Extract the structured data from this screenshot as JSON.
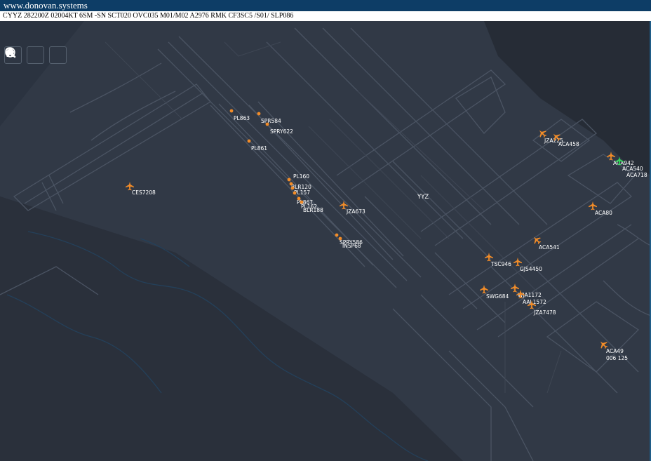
{
  "site": {
    "title": "www.donovan.systems"
  },
  "metar": "CYYZ 282200Z 02004KT 6SM -SN SCT020 OVC035 M01/M02 A2976 RMK CF3SC5 /S01/ SLP086",
  "toolbar": [
    {
      "name": "home-button",
      "icon": "home-icon"
    },
    {
      "name": "globe-button",
      "icon": "globe-icon"
    },
    {
      "name": "search-button",
      "icon": "search-icon"
    }
  ],
  "airport_label": "YYZ",
  "colors": {
    "background": "#2b3340",
    "land": "#333a47",
    "infrastructure": "#4b5463",
    "aircraft": "#f28c28",
    "aircraft_selected": "#34d65a",
    "label": "#ffffff",
    "titlebar": "#0d3d66"
  },
  "aircraft": [
    {
      "callsign": "PL863",
      "kind": "dot"
    },
    {
      "callsign": "SPR584",
      "kind": "dot"
    },
    {
      "callsign": "SPRY622",
      "kind": "dot"
    },
    {
      "callsign": "PL861",
      "kind": "dot"
    },
    {
      "callsign": "CES7208",
      "kind": "plane"
    },
    {
      "callsign": "BLR120",
      "kind": "dot"
    },
    {
      "callsign": "PL157",
      "kind": "dot"
    },
    {
      "callsign": "PL160",
      "kind": "dot"
    },
    {
      "callsign": "PL867",
      "kind": "dot"
    },
    {
      "callsign": "PL162",
      "kind": "dot"
    },
    {
      "callsign": "BLR188",
      "kind": "dot"
    },
    {
      "callsign": "JZA673",
      "kind": "plane"
    },
    {
      "callsign": "SPRY586",
      "kind": "dot"
    },
    {
      "callsign": "INSP68",
      "kind": "dot"
    },
    {
      "callsign": "JZA225",
      "kind": "plane"
    },
    {
      "callsign": "ACA458",
      "kind": "plane"
    },
    {
      "callsign": "ACA942",
      "kind": "plane"
    },
    {
      "callsign": "ACA540",
      "kind": "plane",
      "selected": true
    },
    {
      "callsign": "ACA718",
      "kind": "label"
    },
    {
      "callsign": "ACA80",
      "kind": "plane"
    },
    {
      "callsign": "ACA541",
      "kind": "plane"
    },
    {
      "callsign": "TSC946",
      "kind": "plane"
    },
    {
      "callsign": "GJS4450",
      "kind": "plane"
    },
    {
      "callsign": "SWG684",
      "kind": "plane"
    },
    {
      "callsign": "WJA1172",
      "kind": "plane"
    },
    {
      "callsign": "AAL1572",
      "kind": "plane"
    },
    {
      "callsign": "JZA7478",
      "kind": "plane"
    },
    {
      "callsign": "ACA49",
      "kind": "plane",
      "extra": "006 125"
    }
  ]
}
